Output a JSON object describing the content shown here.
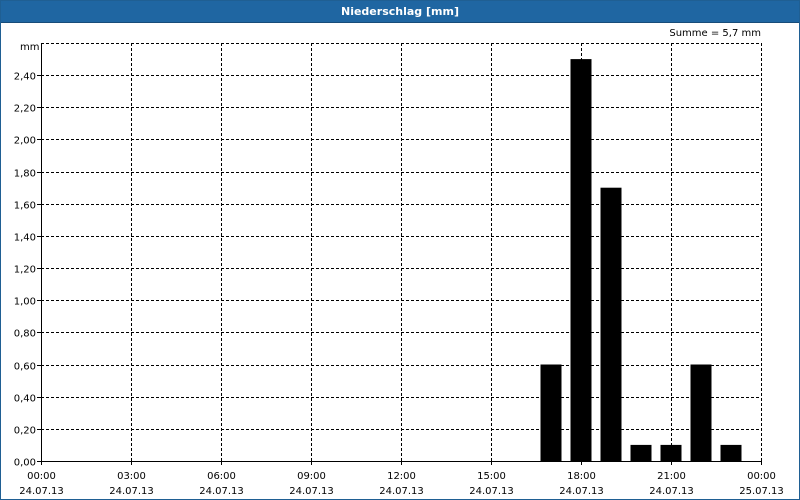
{
  "window": {
    "title": "Niederschlag [mm]"
  },
  "chart_data": {
    "type": "bar",
    "title": "Niederschlag [mm]",
    "ylabel": "mm",
    "annotation": "Summe = 5,7 mm",
    "ylim": [
      0,
      2.6
    ],
    "yticks": [
      {
        "value": 0.0,
        "label": "0,00"
      },
      {
        "value": 0.2,
        "label": "0,20"
      },
      {
        "value": 0.4,
        "label": "0,40"
      },
      {
        "value": 0.6,
        "label": "0,60"
      },
      {
        "value": 0.8,
        "label": "0,80"
      },
      {
        "value": 1.0,
        "label": "1,00"
      },
      {
        "value": 1.2,
        "label": "1,20"
      },
      {
        "value": 1.4,
        "label": "1,40"
      },
      {
        "value": 1.6,
        "label": "1,60"
      },
      {
        "value": 1.8,
        "label": "1,80"
      },
      {
        "value": 2.0,
        "label": "2,00"
      },
      {
        "value": 2.2,
        "label": "2,20"
      },
      {
        "value": 2.4,
        "label": "2,40"
      }
    ],
    "xlim": [
      "24.07.13 00:00",
      "25.07.13 00:00"
    ],
    "xticks": [
      {
        "time": "00:00",
        "date": "24.07.13"
      },
      {
        "time": "03:00",
        "date": "24.07.13"
      },
      {
        "time": "06:00",
        "date": "24.07.13"
      },
      {
        "time": "09:00",
        "date": "24.07.13"
      },
      {
        "time": "12:00",
        "date": "24.07.13"
      },
      {
        "time": "15:00",
        "date": "24.07.13"
      },
      {
        "time": "18:00",
        "date": "24.07.13"
      },
      {
        "time": "21:00",
        "date": "24.07.13"
      },
      {
        "time": "00:00",
        "date": "25.07.13"
      }
    ],
    "bars": [
      {
        "time": "17:00",
        "value": 0.6
      },
      {
        "time": "18:00",
        "value": 2.5
      },
      {
        "time": "19:00",
        "value": 1.7
      },
      {
        "time": "20:00",
        "value": 0.1
      },
      {
        "time": "21:00",
        "value": 0.1
      },
      {
        "time": "22:00",
        "value": 0.6
      },
      {
        "time": "23:00",
        "value": 0.1
      }
    ],
    "bar_color": "#000000",
    "grid": true
  }
}
